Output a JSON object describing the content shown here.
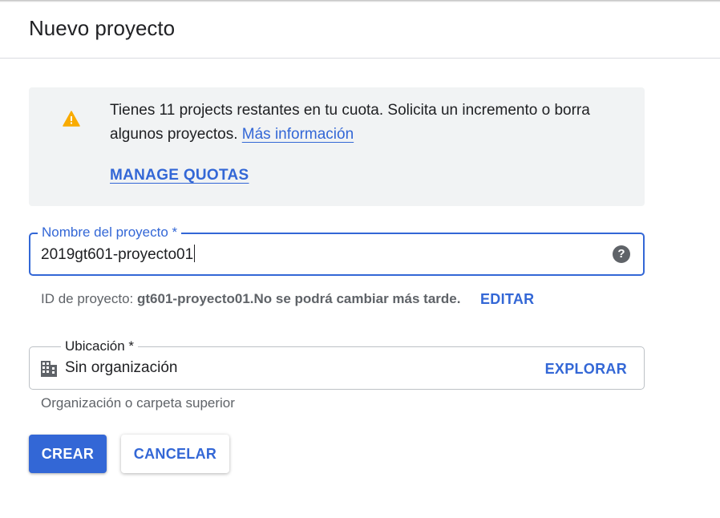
{
  "dialog": {
    "title": "Nuevo proyecto"
  },
  "alert": {
    "icon": "warning-icon",
    "icon_color": "#f9ab00",
    "message": "Tienes 11 projects restantes en tu cuota. Solicita un incremento o borra algunos proyectos.",
    "more_info_link": "Más información",
    "manage_quotas_link": "MANAGE QUOTAS"
  },
  "project_name": {
    "label": "Nombre del proyecto *",
    "value": "2019gt601-proyecto01",
    "help_icon": "help-icon"
  },
  "project_id": {
    "prefix": "ID de proyecto:",
    "id": "gt601-proyecto01.",
    "suffix": "No se podrá cambiar más tarde.",
    "edit_label": "EDITAR"
  },
  "location": {
    "label": "Ubicación *",
    "value": "Sin organización",
    "browse_label": "EXPLORAR",
    "icon": "building-icon",
    "hint": "Organización o carpeta superior"
  },
  "actions": {
    "create_label": "CREAR",
    "cancel_label": "CANCELAR"
  },
  "colors": {
    "accent": "#3367d6",
    "alert_background": "#f1f3f4",
    "warning": "#f9ab00"
  }
}
